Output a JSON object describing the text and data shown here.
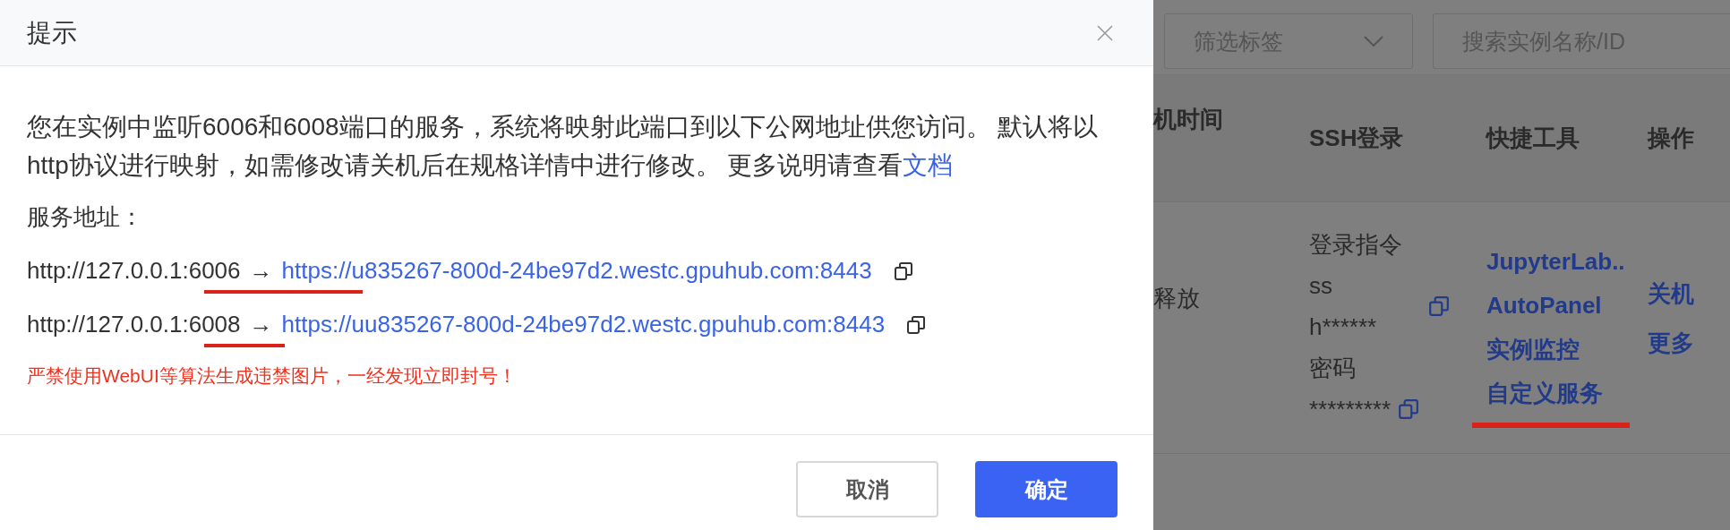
{
  "dialog": {
    "title": "提示",
    "body_text": "您在实例中监听6006和6008端口的服务，系统将映射此端口到以下公网地址供您访问。 默认将以http协议进行映射，如需修改请关机后在规格详情中进行修改。 更多说明请查看",
    "doc_link": "文档",
    "address_label": "服务地址：",
    "mappings": [
      {
        "local": "http://127.0.0.1:6006",
        "arrow": "→",
        "public": "https://u835267-800d-24be97d2.westc.gpuhub.com:8443",
        "underlined": true
      },
      {
        "local": "http://127.0.0.1:6008",
        "arrow": "→",
        "public": "https://uu835267-800d-24be97d2.westc.gpuhub.com:8443",
        "underlined": true
      }
    ],
    "warning": "严禁使用WebUI等算法生成违禁图片，一经发现立即封号！",
    "buttons": [
      {
        "label": "取消",
        "kind": "secondary"
      },
      {
        "label": "确定",
        "kind": "primary"
      }
    ]
  },
  "background": {
    "tag_filter": {
      "placeholder": "筛选标签"
    },
    "search": {
      "placeholder": "搜索实例名称/ID"
    },
    "columns": [
      "机时间",
      "SSH登录",
      "快捷工具",
      "操作"
    ],
    "row": {
      "status": "释放",
      "ssh_label": "登录指令",
      "ssh_lines": [
        "ss",
        "h******"
      ],
      "password_label": "密码",
      "password": "*********",
      "tools": [
        {
          "label": "JupyterLab..",
          "underlined": false
        },
        {
          "label": "AutoPanel",
          "underlined": false
        },
        {
          "label": "实例监控",
          "underlined": false
        },
        {
          "label": "自定义服务",
          "underlined": true
        }
      ],
      "actions": [
        "关机",
        "更多"
      ]
    }
  }
}
